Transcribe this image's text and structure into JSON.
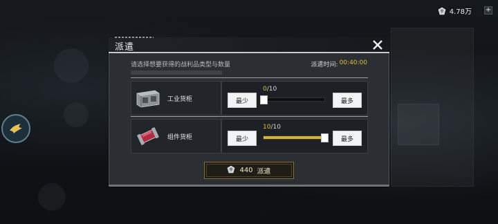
{
  "top_bar": {
    "currency_amount": "4.78万",
    "plus_label": "+",
    "currency_icon": "gem-icon"
  },
  "dialog": {
    "title": "派遣",
    "instruction": "请选择想要获得的战利品类型与数量",
    "time_label": "派遣时间:",
    "time_value": "00:40:00",
    "close_icon": "close-icon",
    "items": [
      {
        "name": "工业货柜",
        "icon": "industrial-container-icon",
        "min_label": "最少",
        "max_label": "最多",
        "current": "0",
        "max": "/10",
        "fill_fraction": 0.0
      },
      {
        "name": "组件货柜",
        "icon": "component-container-icon",
        "min_label": "最少",
        "max_label": "最多",
        "current": "10",
        "max": "/10",
        "fill_fraction": 1.0
      }
    ],
    "dispatch": {
      "cost": "440",
      "label": "派遣",
      "icon": "gem-icon"
    }
  },
  "colors": {
    "accent_gold": "#e3bd3a",
    "slider_fill": "#d9b233",
    "dialog_bg": "#2b2f33"
  }
}
